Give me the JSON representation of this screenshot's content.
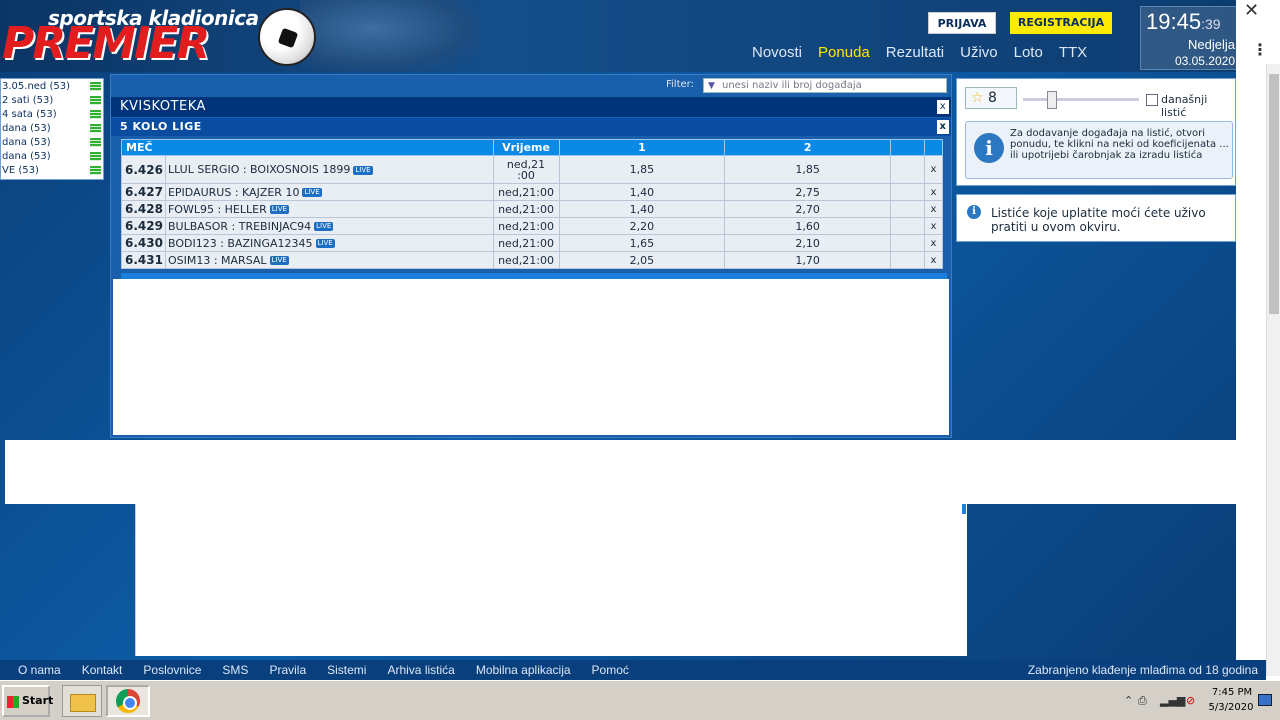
{
  "header": {
    "logo_top": "sportska kladionica",
    "logo_main": "PREMIER",
    "login": "PRIJAVA",
    "register": "REGISTRACIJA",
    "nav": [
      "Novosti",
      "Ponuda",
      "Rezultati",
      "Uživo",
      "Loto",
      "TTX"
    ],
    "nav_active": "Ponuda",
    "clock_time": "19:45",
    "clock_seconds": ":39",
    "clock_day": "Nedjelja",
    "clock_date": "03.05.2020"
  },
  "left_panel": {
    "items": [
      {
        "label": "3.05.ned (53)"
      },
      {
        "label": "2 sati (53)"
      },
      {
        "label": "4 sata (53)"
      },
      {
        "label": "dana (53)"
      },
      {
        "label": "dana (53)"
      },
      {
        "label": "dana (53)"
      },
      {
        "label": "VE (53)"
      }
    ]
  },
  "center": {
    "filter_label": "Filter:",
    "filter_placeholder": "unesi naziv ili broj događaja",
    "title": "KVISKOTEKA",
    "subtitle": "5 KOLO LIGE",
    "close": "x",
    "columns": [
      "MEČ",
      "Vrijeme",
      "1",
      "2"
    ],
    "live_label": "LIVE",
    "rows": [
      {
        "num": "6.426",
        "match": "LLUL SERGIO : BOIXOSNOIS 1899",
        "time": "ned,21\n:00",
        "o1": "1,85",
        "o2": "1,85"
      },
      {
        "num": "6.427",
        "match": "EPIDAURUS : KAJZER 10",
        "time": "ned,21:00",
        "o1": "1,40",
        "o2": "2,75"
      },
      {
        "num": "6.428",
        "match": "FOWL95 : HELLER",
        "time": "ned,21:00",
        "o1": "1,40",
        "o2": "2,70"
      },
      {
        "num": "6.429",
        "match": "BULBASOR : TREBINJAC94",
        "time": "ned,21:00",
        "o1": "2,20",
        "o2": "1,60"
      },
      {
        "num": "6.430",
        "match": "BODI123 : BAZINGA12345",
        "time": "ned,21:00",
        "o1": "1,65",
        "o2": "2,10"
      },
      {
        "num": "6.431",
        "match": "OSIM13 : MARSAL",
        "time": "ned,21:00",
        "o1": "2,05",
        "o2": "1,70"
      }
    ]
  },
  "slip": {
    "count": "8",
    "today_label": "današnji listić",
    "info": "Za dodavanje događaja na listić, otvori ponudu, te klikni na neki od koeficijenata ... ili upotrijebi čarobnjak za izradu listića",
    "notice": "Listiće koje uplatite moći ćete uživo pratiti u ovom okviru."
  },
  "footer": {
    "links": [
      "O nama",
      "Kontakt",
      "Poslovnice",
      "SMS",
      "Pravila",
      "Sistemi",
      "Arhiva listića",
      "Mobilna aplikacija",
      "Pomoć"
    ],
    "right": "Zabranjeno klađenje mlađima od 18 godina"
  },
  "taskbar": {
    "start": "Start",
    "time": "7:45 PM",
    "date": "5/3/2020"
  }
}
